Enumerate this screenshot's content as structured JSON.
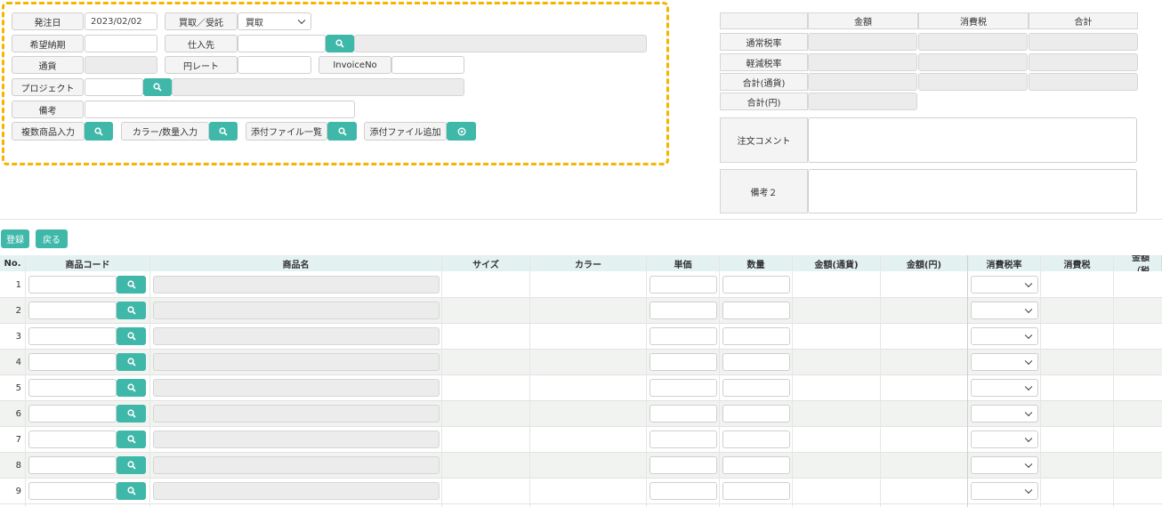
{
  "header": {
    "order_date_label": "発注日",
    "order_date_value": "2023/02/02",
    "type_label": "買取／受託",
    "type_selected": "買取",
    "desired_delivery_label": "希望納期",
    "supplier_label": "仕入先",
    "currency_label": "通貨",
    "yen_rate_label": "円レート",
    "invoice_label": "InvoiceNo",
    "project_label": "プロジェクト",
    "remarks_label": "備考",
    "multi_product_label": "複数商品入力",
    "color_qty_label": "カラー/数量入力",
    "attach_list_label": "添付ファイル一覧",
    "attach_add_label": "添付ファイル追加"
  },
  "summary": {
    "col_amount": "金額",
    "col_tax": "消費税",
    "col_total": "合計",
    "row_normal": "通常税率",
    "row_reduced": "軽減税率",
    "row_total_currency": "合計(通貨)",
    "row_total_yen": "合計(円)",
    "order_comment_label": "注文コメント",
    "remarks2_label": "備考２"
  },
  "actions": {
    "register": "登録",
    "back": "戻る"
  },
  "table": {
    "columns": [
      "No.",
      "商品コード",
      "商品名",
      "サイズ",
      "カラー",
      "単価",
      "数量",
      "金額(通貨)",
      "金額(円)",
      "消費税率",
      "消費税",
      "金額（税"
    ],
    "rows": [
      "1",
      "2",
      "3",
      "4",
      "5",
      "6",
      "7",
      "8",
      "9"
    ]
  },
  "colors": {
    "accent": "#3fb8a9",
    "highlight_border": "#f5b400",
    "header_bg": "#e4f1f1",
    "alt_row_bg": "#f0f3ef"
  },
  "icons": {
    "search": "search-icon",
    "add": "plus-circle-icon",
    "dropdown": "chevron-down-icon"
  }
}
